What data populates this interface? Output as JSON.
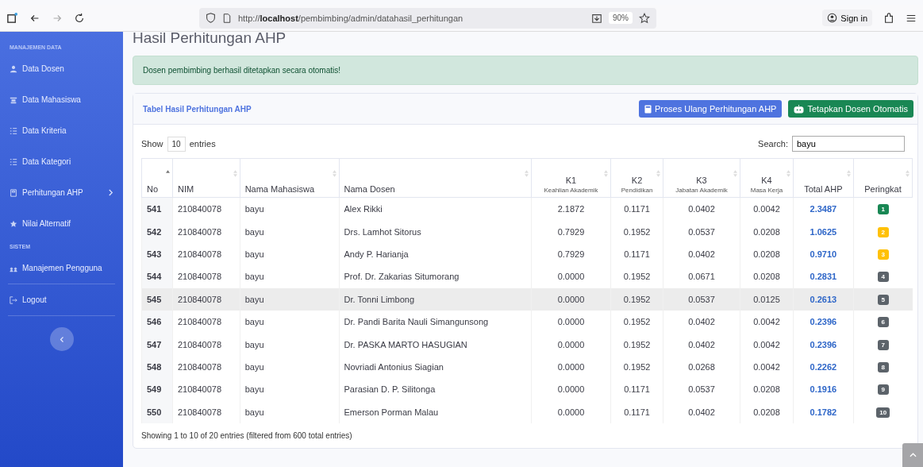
{
  "browser": {
    "url_prefix": "http://",
    "url_host": "localhost",
    "url_path": "/pembimbing/admin/datahasil_perhitungan",
    "zoom": "90%",
    "sign_in": "Sign in"
  },
  "sidebar": {
    "sections": [
      {
        "heading": "MANAJEMEN DATA",
        "items": [
          {
            "label": "Data Dosen",
            "expandable": false
          },
          {
            "label": "Data Mahasiswa",
            "expandable": false
          },
          {
            "label": "Data Kriteria",
            "expandable": false
          },
          {
            "label": "Data Kategori",
            "expandable": false
          },
          {
            "label": "Perhitungan AHP",
            "expandable": true
          },
          {
            "label": "Nilai Alternatif",
            "expandable": false
          }
        ]
      },
      {
        "heading": "SISTEM",
        "items": [
          {
            "label": "Manajemen Pengguna",
            "expandable": false
          }
        ]
      }
    ],
    "logout": "Logout"
  },
  "page_title": "Hasil Perhitungan AHP",
  "alert": "Dosen pembimbing berhasil ditetapkan secara otomatis!",
  "card": {
    "title": "Tabel Hasil Perhitungan AHP",
    "buttons": [
      {
        "label": "Proses Ulang Perhitungan AHP",
        "kind": "primary"
      },
      {
        "label": "Tetapkan Dosen Otomatis",
        "kind": "success"
      }
    ]
  },
  "length": {
    "before": "Show",
    "value": "10",
    "after": "entries"
  },
  "search": {
    "label": "Search:",
    "value": "bayu"
  },
  "table": {
    "columns": [
      {
        "label": "No",
        "sorted": true
      },
      {
        "label": "NIM",
        "sorted": false
      },
      {
        "label": "Nama Mahasiswa",
        "sorted": false
      },
      {
        "label": "Nama Dosen",
        "sorted": false
      },
      {
        "label": "K1",
        "sub": "Keahlian Akademik",
        "sorted": false
      },
      {
        "label": "K2",
        "sub": "Pendidikan",
        "sorted": false
      },
      {
        "label": "K3",
        "sub": "Jabatan Akademik",
        "sorted": false
      },
      {
        "label": "K4",
        "sub": "Masa Kerja",
        "sorted": false
      },
      {
        "label": "Total AHP",
        "sorted": false
      },
      {
        "label": "Peringkat",
        "sorted": false
      }
    ],
    "rows": [
      {
        "no": "541",
        "nim": "210840078",
        "mhs": "bayu",
        "dosen": "Alex Rikki",
        "k": [
          "2.1872",
          "0.1171",
          "0.0402",
          "0.0042"
        ],
        "total": "2.3487",
        "rank": "1",
        "color": "#198754",
        "selected": false
      },
      {
        "no": "542",
        "nim": "210840078",
        "mhs": "bayu",
        "dosen": "Drs. Lamhot Sitorus",
        "k": [
          "0.7929",
          "0.1952",
          "0.0537",
          "0.0208"
        ],
        "total": "1.0625",
        "rank": "2",
        "color": "#ffc107",
        "selected": false
      },
      {
        "no": "543",
        "nim": "210840078",
        "mhs": "bayu",
        "dosen": "Andy P. Harianja",
        "k": [
          "0.7929",
          "0.1171",
          "0.0402",
          "0.0208"
        ],
        "total": "0.9710",
        "rank": "3",
        "color": "#ffc107",
        "selected": false
      },
      {
        "no": "544",
        "nim": "210840078",
        "mhs": "bayu",
        "dosen": "Prof. Dr. Zakarias Situmorang",
        "k": [
          "0.0000",
          "0.1952",
          "0.0671",
          "0.0208"
        ],
        "total": "0.2831",
        "rank": "4",
        "color": "#5c636a",
        "selected": false
      },
      {
        "no": "545",
        "nim": "210840078",
        "mhs": "bayu",
        "dosen": "Dr. Tonni Limbong",
        "k": [
          "0.0000",
          "0.1952",
          "0.0537",
          "0.0125"
        ],
        "total": "0.2613",
        "rank": "5",
        "color": "#5c636a",
        "selected": true
      },
      {
        "no": "546",
        "nim": "210840078",
        "mhs": "bayu",
        "dosen": "Dr. Pandi Barita Nauli Simangunsong",
        "k": [
          "0.0000",
          "0.1952",
          "0.0402",
          "0.0042"
        ],
        "total": "0.2396",
        "rank": "6",
        "color": "#5c636a",
        "selected": false
      },
      {
        "no": "547",
        "nim": "210840078",
        "mhs": "bayu",
        "dosen": "Dr. PASKA MARTO HASUGIAN",
        "k": [
          "0.0000",
          "0.1952",
          "0.0402",
          "0.0042"
        ],
        "total": "0.2396",
        "rank": "7",
        "color": "#5c636a",
        "selected": false
      },
      {
        "no": "548",
        "nim": "210840078",
        "mhs": "bayu",
        "dosen": "Novriadi Antonius Siagian",
        "k": [
          "0.0000",
          "0.1952",
          "0.0268",
          "0.0042"
        ],
        "total": "0.2262",
        "rank": "8",
        "color": "#5c636a",
        "selected": false
      },
      {
        "no": "549",
        "nim": "210840078",
        "mhs": "bayu",
        "dosen": "Parasian D. P. Silitonga",
        "k": [
          "0.0000",
          "0.1171",
          "0.0537",
          "0.0208"
        ],
        "total": "0.1916",
        "rank": "9",
        "color": "#5c636a",
        "selected": false
      },
      {
        "no": "550",
        "nim": "210840078",
        "mhs": "bayu",
        "dosen": "Emerson Porman Malau",
        "k": [
          "0.0000",
          "0.1171",
          "0.0402",
          "0.0208"
        ],
        "total": "0.1782",
        "rank": "10",
        "color": "#5c636a",
        "selected": false
      }
    ]
  },
  "info": "Showing 1 to 10 of 20 entries (filtered from 600 total entries)"
}
